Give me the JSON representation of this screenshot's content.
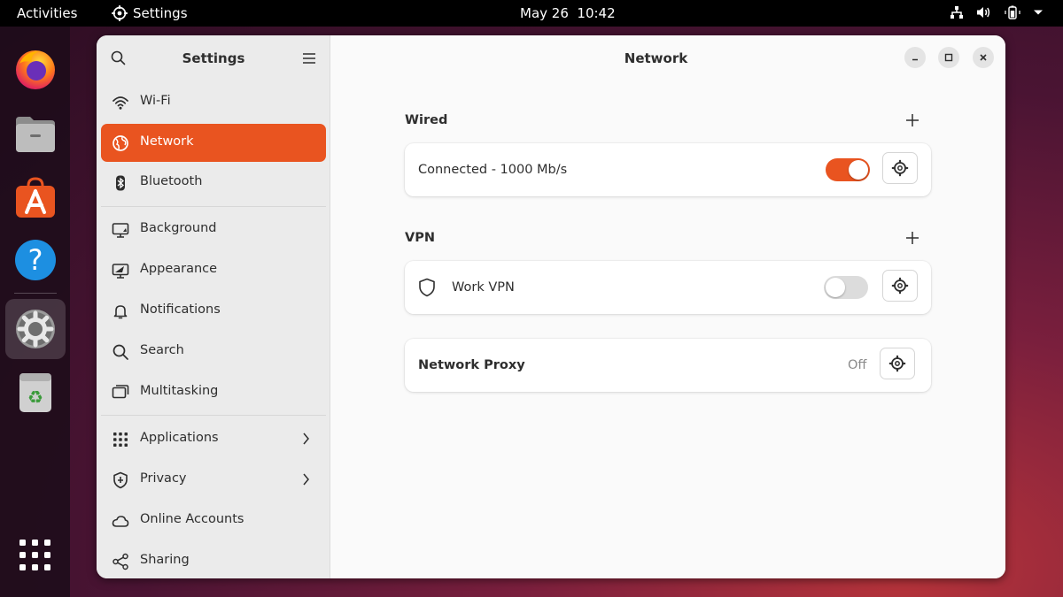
{
  "topbar": {
    "activities": "Activities",
    "app_name": "Settings",
    "clock": "May 26  10:42"
  },
  "dock": {
    "apps": [
      "firefox-icon",
      "files-icon",
      "app-center-icon",
      "help-icon",
      "settings-icon",
      "trash-icon",
      "app-grid-icon"
    ],
    "active": "settings-icon"
  },
  "sidebar": {
    "title": "Settings",
    "items": [
      {
        "label": "Wi-Fi",
        "icon": "wifi-icon"
      },
      {
        "label": "Network",
        "icon": "globe-icon",
        "active": true
      },
      {
        "label": "Bluetooth",
        "icon": "bluetooth-icon"
      },
      {
        "label": "Background",
        "icon": "background-icon"
      },
      {
        "label": "Appearance",
        "icon": "appearance-icon"
      },
      {
        "label": "Notifications",
        "icon": "bell-icon"
      },
      {
        "label": "Search",
        "icon": "search-icon"
      },
      {
        "label": "Multitasking",
        "icon": "multitasking-icon"
      },
      {
        "label": "Applications",
        "icon": "apps-grid-icon",
        "has_submenu": true
      },
      {
        "label": "Privacy",
        "icon": "privacy-shield-icon",
        "has_submenu": true
      },
      {
        "label": "Online Accounts",
        "icon": "cloud-icon"
      },
      {
        "label": "Sharing",
        "icon": "share-icon"
      }
    ]
  },
  "main": {
    "title": "Network",
    "wired": {
      "title": "Wired",
      "status": "Connected - 1000 Mb/s",
      "enabled": true
    },
    "vpn": {
      "title": "VPN",
      "name": "Work VPN",
      "enabled": false
    },
    "proxy": {
      "label": "Network Proxy",
      "status": "Off"
    }
  },
  "colors": {
    "accent": "#e95420",
    "sidebar_bg": "#ebebeb",
    "content_bg": "#fafafa"
  }
}
